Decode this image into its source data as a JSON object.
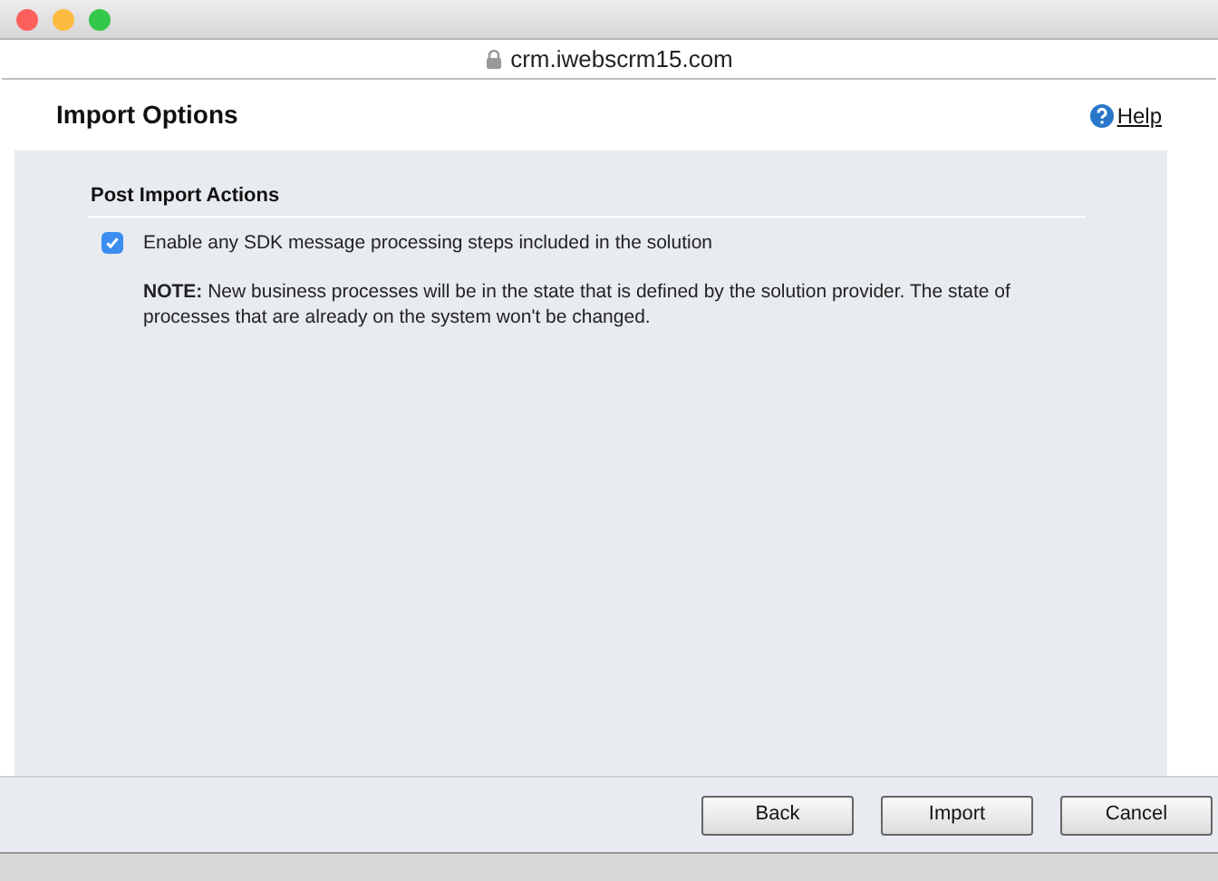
{
  "window": {
    "url": "crm.iwebscrm15.com"
  },
  "header": {
    "title": "Import Options",
    "help": "Help"
  },
  "section": {
    "title": "Post Import Actions",
    "option": {
      "label": "Enable any SDK message processing steps included in the solution",
      "checked": true
    },
    "note": "**NOTE:** New business processes will be in the state that is defined by the solution provider. The state of processes that are already on the system won't be changed."
  },
  "buttons": [
    {
      "label": "Back"
    },
    {
      "label": "Import"
    },
    {
      "label": "Cancel"
    }
  ]
}
